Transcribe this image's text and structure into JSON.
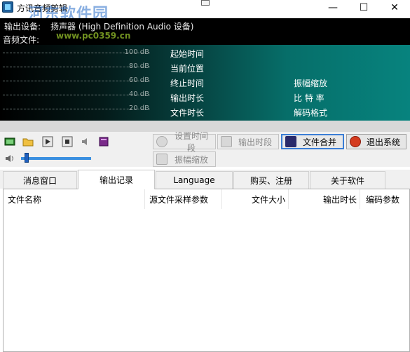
{
  "window": {
    "title": "方讯音频剪辑",
    "watermark": "河东软件园",
    "watermark_url": "www.pc0359.cn",
    "minimize": "—",
    "maximize": "☐",
    "close": "✕"
  },
  "devices": {
    "output_label": "输出设备:",
    "output_value": "扬声器 (High Definition Audio 设备)",
    "file_label": "音频文件:"
  },
  "meter": {
    "levels": [
      "100 dB",
      "80 dB",
      "60 dB",
      "40 dB",
      "20 dB"
    ]
  },
  "info": {
    "col1": [
      "起始时间",
      "当前位置",
      "终止时间",
      "输出时长",
      "文件时长"
    ],
    "col2": [
      "振幅缩放",
      "比 特 率",
      "解码格式"
    ]
  },
  "toolbar": {
    "set_segment": "设置时间段",
    "output_segment": "输出时段",
    "merge_files": "文件合并",
    "exit_system": "退出系统",
    "amplitude_zoom": "振幅缩放"
  },
  "volume": {
    "level": 0.05
  },
  "tabs": [
    {
      "label": "消息窗口"
    },
    {
      "label": "输出记录"
    },
    {
      "label": "Language"
    },
    {
      "label": "购买、注册"
    },
    {
      "label": "关于软件"
    }
  ],
  "active_tab": 1,
  "table": {
    "columns": [
      "文件名称",
      "源文件采样参数",
      "文件大小",
      "输出时长",
      "编码参数"
    ]
  },
  "colors": {
    "panel_gradient_end": "#07837e",
    "accent_blue": "#3b7ed6"
  }
}
